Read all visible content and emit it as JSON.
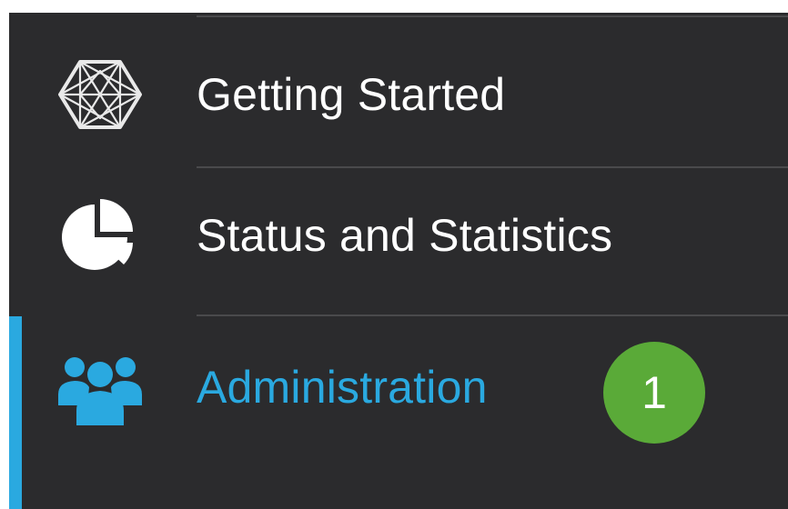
{
  "nav": {
    "items": [
      {
        "label": "Getting Started",
        "icon": "getting-started-icon",
        "active": false
      },
      {
        "label": "Status and Statistics",
        "icon": "pie-chart-icon",
        "active": false
      },
      {
        "label": "Administration",
        "icon": "users-icon",
        "active": true
      }
    ]
  },
  "annotation": {
    "badge": "1"
  },
  "colors": {
    "background": "#2b2b2d",
    "accent": "#2aa9e0",
    "badge": "#5aaa38",
    "divider": "#4a4a4c"
  }
}
